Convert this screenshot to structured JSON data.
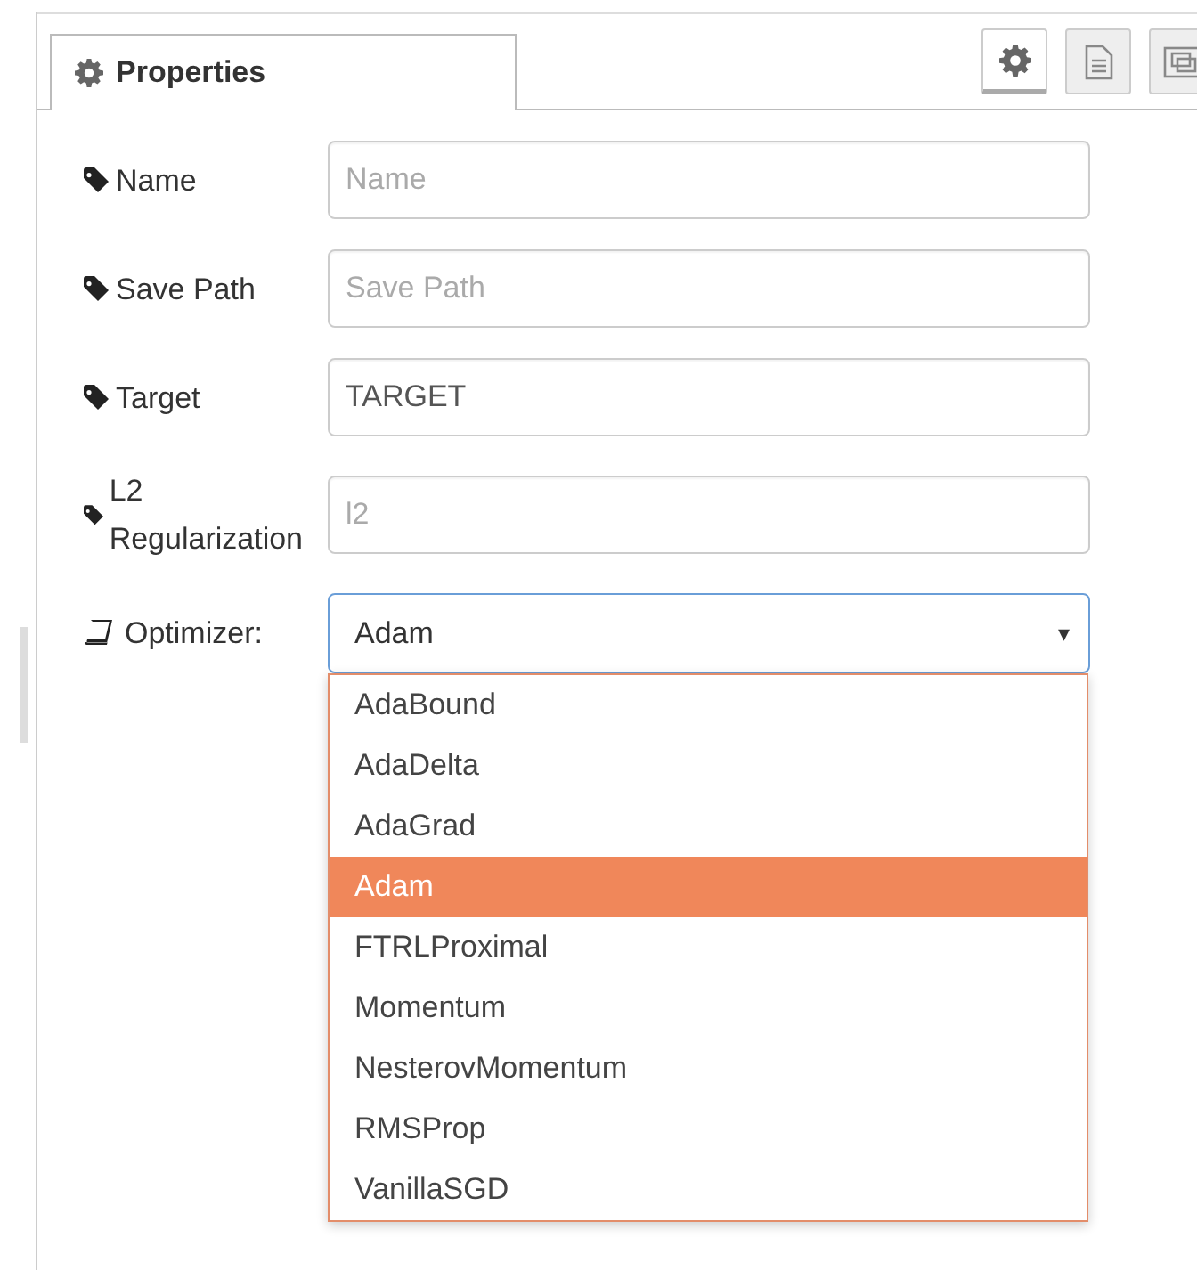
{
  "tab": {
    "label": "Properties",
    "selected": true
  },
  "toolbar": [
    {
      "kind": "gear",
      "selected": true
    },
    {
      "kind": "document",
      "selected": false
    },
    {
      "kind": "frame",
      "selected": false
    }
  ],
  "fields": [
    {
      "kind": "text",
      "label": "Name",
      "placeholder": "Name"
    },
    {
      "kind": "text",
      "label": "Save Path",
      "placeholder": "Save Path"
    },
    {
      "kind": "text",
      "label": "Target",
      "value": "TARGET"
    },
    {
      "kind": "text",
      "label": "L2 Regularization",
      "placeholder": "l2"
    },
    {
      "kind": "select",
      "label": "Optimizer:",
      "value": "Adam",
      "caret": "▾",
      "expanded": true,
      "options": [
        {
          "label": "AdaBound",
          "selected": false
        },
        {
          "label": "AdaDelta",
          "selected": false
        },
        {
          "label": "AdaGrad",
          "selected": false
        },
        {
          "label": "Adam",
          "selected": true
        },
        {
          "label": "FTRLProximal",
          "selected": false
        },
        {
          "label": "Momentum",
          "selected": false
        },
        {
          "label": "NesterovMomentum",
          "selected": false
        },
        {
          "label": "RMSProp",
          "selected": false
        },
        {
          "label": "VanillaSGD",
          "selected": false
        }
      ]
    }
  ]
}
